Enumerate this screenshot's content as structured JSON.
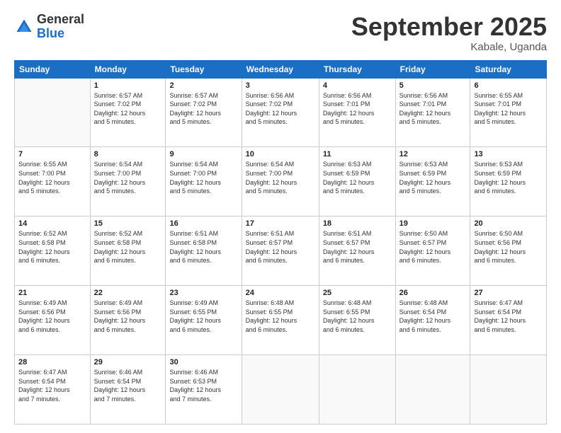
{
  "logo": {
    "general": "General",
    "blue": "Blue"
  },
  "header": {
    "month": "September 2025",
    "location": "Kabale, Uganda"
  },
  "days_of_week": [
    "Sunday",
    "Monday",
    "Tuesday",
    "Wednesday",
    "Thursday",
    "Friday",
    "Saturday"
  ],
  "weeks": [
    [
      {
        "day": "",
        "info": ""
      },
      {
        "day": "1",
        "info": "Sunrise: 6:57 AM\nSunset: 7:02 PM\nDaylight: 12 hours\nand 5 minutes."
      },
      {
        "day": "2",
        "info": "Sunrise: 6:57 AM\nSunset: 7:02 PM\nDaylight: 12 hours\nand 5 minutes."
      },
      {
        "day": "3",
        "info": "Sunrise: 6:56 AM\nSunset: 7:02 PM\nDaylight: 12 hours\nand 5 minutes."
      },
      {
        "day": "4",
        "info": "Sunrise: 6:56 AM\nSunset: 7:01 PM\nDaylight: 12 hours\nand 5 minutes."
      },
      {
        "day": "5",
        "info": "Sunrise: 6:56 AM\nSunset: 7:01 PM\nDaylight: 12 hours\nand 5 minutes."
      },
      {
        "day": "6",
        "info": "Sunrise: 6:55 AM\nSunset: 7:01 PM\nDaylight: 12 hours\nand 5 minutes."
      }
    ],
    [
      {
        "day": "7",
        "info": "Sunrise: 6:55 AM\nSunset: 7:00 PM\nDaylight: 12 hours\nand 5 minutes."
      },
      {
        "day": "8",
        "info": "Sunrise: 6:54 AM\nSunset: 7:00 PM\nDaylight: 12 hours\nand 5 minutes."
      },
      {
        "day": "9",
        "info": "Sunrise: 6:54 AM\nSunset: 7:00 PM\nDaylight: 12 hours\nand 5 minutes."
      },
      {
        "day": "10",
        "info": "Sunrise: 6:54 AM\nSunset: 7:00 PM\nDaylight: 12 hours\nand 5 minutes."
      },
      {
        "day": "11",
        "info": "Sunrise: 6:53 AM\nSunset: 6:59 PM\nDaylight: 12 hours\nand 5 minutes."
      },
      {
        "day": "12",
        "info": "Sunrise: 6:53 AM\nSunset: 6:59 PM\nDaylight: 12 hours\nand 5 minutes."
      },
      {
        "day": "13",
        "info": "Sunrise: 6:53 AM\nSunset: 6:59 PM\nDaylight: 12 hours\nand 6 minutes."
      }
    ],
    [
      {
        "day": "14",
        "info": "Sunrise: 6:52 AM\nSunset: 6:58 PM\nDaylight: 12 hours\nand 6 minutes."
      },
      {
        "day": "15",
        "info": "Sunrise: 6:52 AM\nSunset: 6:58 PM\nDaylight: 12 hours\nand 6 minutes."
      },
      {
        "day": "16",
        "info": "Sunrise: 6:51 AM\nSunset: 6:58 PM\nDaylight: 12 hours\nand 6 minutes."
      },
      {
        "day": "17",
        "info": "Sunrise: 6:51 AM\nSunset: 6:57 PM\nDaylight: 12 hours\nand 6 minutes."
      },
      {
        "day": "18",
        "info": "Sunrise: 6:51 AM\nSunset: 6:57 PM\nDaylight: 12 hours\nand 6 minutes."
      },
      {
        "day": "19",
        "info": "Sunrise: 6:50 AM\nSunset: 6:57 PM\nDaylight: 12 hours\nand 6 minutes."
      },
      {
        "day": "20",
        "info": "Sunrise: 6:50 AM\nSunset: 6:56 PM\nDaylight: 12 hours\nand 6 minutes."
      }
    ],
    [
      {
        "day": "21",
        "info": "Sunrise: 6:49 AM\nSunset: 6:56 PM\nDaylight: 12 hours\nand 6 minutes."
      },
      {
        "day": "22",
        "info": "Sunrise: 6:49 AM\nSunset: 6:56 PM\nDaylight: 12 hours\nand 6 minutes."
      },
      {
        "day": "23",
        "info": "Sunrise: 6:49 AM\nSunset: 6:55 PM\nDaylight: 12 hours\nand 6 minutes."
      },
      {
        "day": "24",
        "info": "Sunrise: 6:48 AM\nSunset: 6:55 PM\nDaylight: 12 hours\nand 6 minutes."
      },
      {
        "day": "25",
        "info": "Sunrise: 6:48 AM\nSunset: 6:55 PM\nDaylight: 12 hours\nand 6 minutes."
      },
      {
        "day": "26",
        "info": "Sunrise: 6:48 AM\nSunset: 6:54 PM\nDaylight: 12 hours\nand 6 minutes."
      },
      {
        "day": "27",
        "info": "Sunrise: 6:47 AM\nSunset: 6:54 PM\nDaylight: 12 hours\nand 6 minutes."
      }
    ],
    [
      {
        "day": "28",
        "info": "Sunrise: 6:47 AM\nSunset: 6:54 PM\nDaylight: 12 hours\nand 7 minutes."
      },
      {
        "day": "29",
        "info": "Sunrise: 6:46 AM\nSunset: 6:54 PM\nDaylight: 12 hours\nand 7 minutes."
      },
      {
        "day": "30",
        "info": "Sunrise: 6:46 AM\nSunset: 6:53 PM\nDaylight: 12 hours\nand 7 minutes."
      },
      {
        "day": "",
        "info": ""
      },
      {
        "day": "",
        "info": ""
      },
      {
        "day": "",
        "info": ""
      },
      {
        "day": "",
        "info": ""
      }
    ]
  ]
}
